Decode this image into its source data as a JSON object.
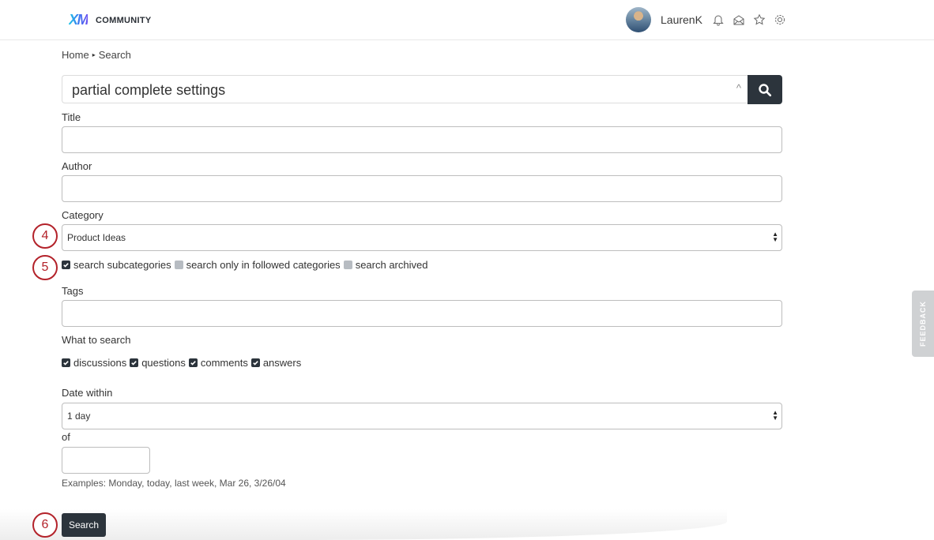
{
  "header": {
    "logo_mark": "XM",
    "logo_text": "COMMUNITY",
    "username": "LaurenK",
    "icons": [
      "bell-icon",
      "envelope-icon",
      "star-icon",
      "gear-icon"
    ]
  },
  "breadcrumb": {
    "items": [
      "Home",
      "Search"
    ],
    "separator": "▸"
  },
  "search": {
    "query": "partial complete settings",
    "caret": "^"
  },
  "form": {
    "title_label": "Title",
    "title_value": "",
    "author_label": "Author",
    "author_value": "",
    "category_label": "Category",
    "category_value": "Product Ideas",
    "category_options": [
      {
        "label": "search subcategories",
        "checked": true
      },
      {
        "label": "search only in followed categories",
        "checked": false
      },
      {
        "label": "search archived",
        "checked": false
      }
    ],
    "tags_label": "Tags",
    "tags_value": "",
    "what_label": "What to search",
    "what_options": [
      {
        "label": "discussions",
        "checked": true
      },
      {
        "label": "questions",
        "checked": true
      },
      {
        "label": "comments",
        "checked": true
      },
      {
        "label": "answers",
        "checked": true
      }
    ],
    "date_label": "Date within",
    "date_value": "1 day",
    "of_label": "of",
    "of_value": "",
    "hint": "Examples: Monday, today, last week, Mar 26, 3/26/04",
    "submit_label": "Search"
  },
  "markers": [
    "4",
    "5",
    "6"
  ],
  "feedback_label": "FEEDBACK",
  "colors": {
    "dark_button": "#2c343c",
    "marker_red": "#b3222a",
    "unchecked": "#b7bcc2"
  }
}
